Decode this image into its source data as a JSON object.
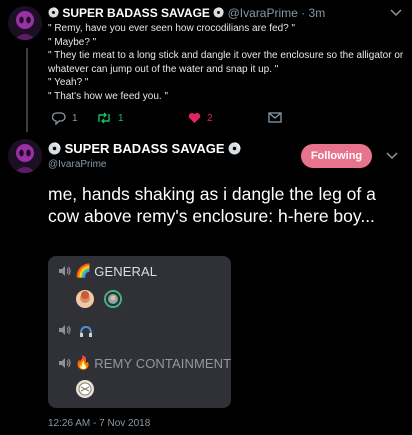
{
  "reply_tweet": {
    "display_name": "SUPER BADASS SAVAGE",
    "handle": "@IvaraPrime",
    "age": "3m",
    "lines": [
      "\" Remy, have you ever seen how crocodilians are fed? \"",
      "\" Maybe? \"",
      "\" They tie meat to a long stick and dangle it over the enclosure so the alligator or whatever can jump out of the water and snap it up. \"",
      "\" Yeah? \"",
      "\" That's how we feed you. \""
    ],
    "reply_count": "1",
    "retweet_count": "1",
    "like_count": "2"
  },
  "main_tweet": {
    "display_name": "SUPER BADASS SAVAGE",
    "handle": "@IvaraPrime",
    "follow_label": "Following",
    "text": "me, hands shaking as i dangle the leg of a cow above remy's enclosure: h-here boy...",
    "timestamp": "12:26 AM - 7 Nov 2018"
  },
  "voice_channels": [
    {
      "emoji": "🌈",
      "name": "GENERAL",
      "users": [
        "user-avatar-1",
        "user-avatar-2"
      ]
    },
    {
      "emoji": "",
      "name": "",
      "users": [
        "user-avatar-3"
      ]
    },
    {
      "emoji": "🔥",
      "name": "REMY CONTAINMENT",
      "users": [
        "user-avatar-4"
      ]
    }
  ],
  "colors": {
    "background": "#000000",
    "follow_button": "#e8738c",
    "retweet": "#17bf63",
    "like": "#e0245e",
    "muted_text": "#8899a6",
    "discord_panel": "#2f3136"
  }
}
